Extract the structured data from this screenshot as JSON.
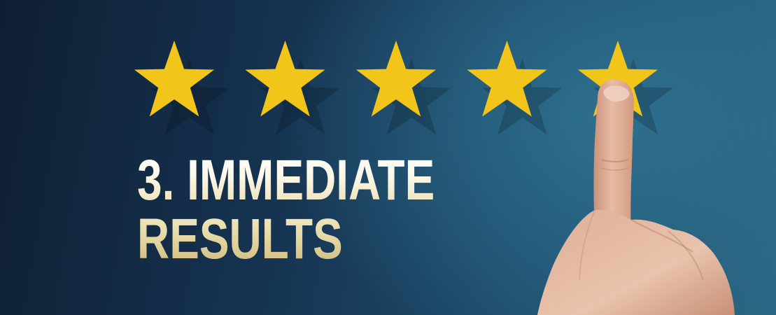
{
  "headline": {
    "line1": "3. IMMEDIATE",
    "line2": "RESULTS"
  },
  "rating": {
    "stars_total": 5,
    "stars_filled": 5,
    "selected_star": 5
  },
  "colors": {
    "star": "#f2c51a",
    "background_dark": "#0f1e33",
    "background_light": "#2a6682",
    "text": "#fbf7e6"
  },
  "icons": {
    "star": "star-icon",
    "pointer": "pointing-finger"
  }
}
